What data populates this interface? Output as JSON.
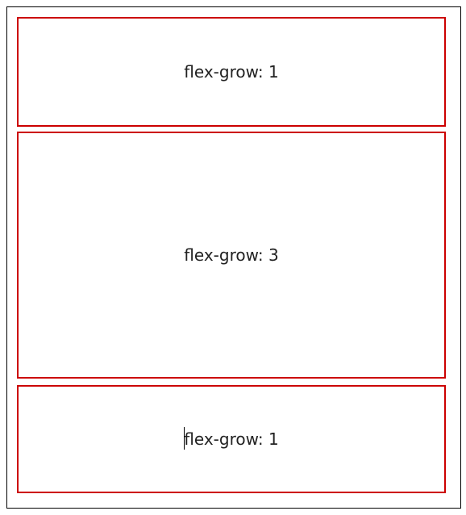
{
  "boxes": [
    {
      "label": "flex-grow: 1"
    },
    {
      "label": "flex-grow: 3"
    },
    {
      "label": "flex-grow: 1"
    }
  ],
  "colors": {
    "box_border": "#cc0000",
    "container_border": "#000000",
    "text": "#222222"
  }
}
